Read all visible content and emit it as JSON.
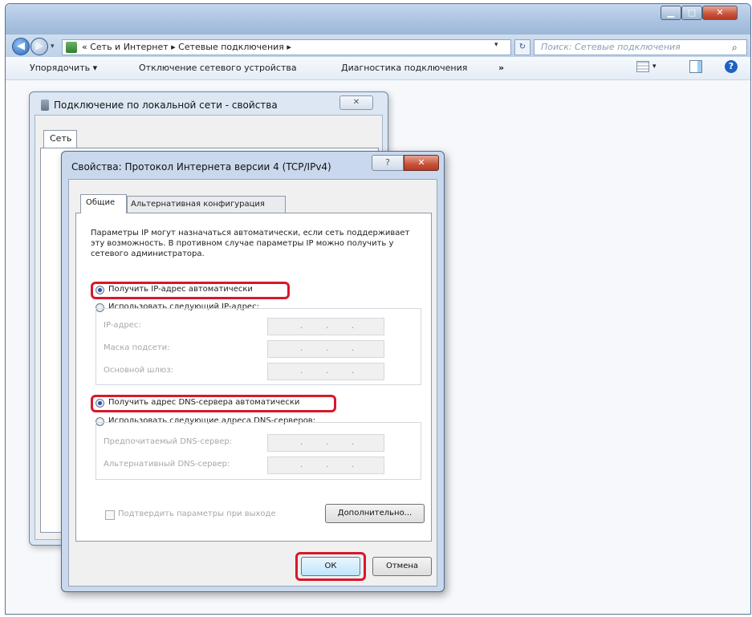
{
  "explorer": {
    "address_text": "« Сеть и Интернет ▸ Сетевые подключения ▸",
    "search_placeholder": "Поиск: Сетевые подключения",
    "toolbar": {
      "organize": "Упорядочить ▾",
      "disable_device": "Отключение сетевого устройства",
      "diagnose": "Диагностика подключения",
      "more": "»"
    }
  },
  "lan_dialog": {
    "title": "Подключение по локальной сети - свойства",
    "tab_network": "Сеть"
  },
  "ipv4_dialog": {
    "title": "Свойства: Протокол Интернета версии 4 (TCP/IPv4)",
    "tabs": {
      "general": "Общие",
      "alternate": "Альтернативная конфигурация"
    },
    "description": "Параметры IP могут назначаться автоматически, если сеть поддерживает эту возможность. В противном случае параметры IP можно получить у сетевого администратора.",
    "ip_auto": "Получить IP-адрес автоматически",
    "ip_manual": "Использовать следующий IP-адрес:",
    "ip_address_label": "IP-адрес:",
    "subnet_label": "Маска подсети:",
    "gateway_label": "Основной шлюз:",
    "dns_auto": "Получить адрес DNS-сервера автоматически",
    "dns_manual": "Использовать следующие адреса DNS-серверов:",
    "preferred_dns_label": "Предпочитаемый DNS-сервер:",
    "alternate_dns_label": "Альтернативный DNS-сервер:",
    "validate_on_exit": "Подтвердить параметры при выходе",
    "advanced_button": "Дополнительно...",
    "ok_button": "ОК",
    "cancel_button": "Отмена",
    "selected": {
      "ip": "auto",
      "dns": "auto"
    }
  },
  "colors": {
    "highlight": "#d8182a",
    "accent": "#1f54b4"
  }
}
